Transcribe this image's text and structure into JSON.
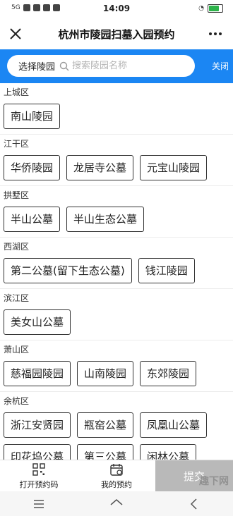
{
  "status": {
    "time": "14:09",
    "network": "5G",
    "battery_level": 0.85,
    "colors": {
      "battery": "#2db34a"
    }
  },
  "header": {
    "title": "杭州市陵园扫墓入园预约"
  },
  "search": {
    "scope_label": "选择陵园",
    "placeholder": "搜索陵园名称",
    "close_label": "关闭",
    "colors": {
      "bar": "#1b86f3"
    }
  },
  "districts": [
    {
      "name": "上城区",
      "cemeteries": [
        "南山陵园"
      ]
    },
    {
      "name": "江干区",
      "cemeteries": [
        "华侨陵园",
        "龙居寺公墓",
        "元宝山陵园"
      ]
    },
    {
      "name": "拱墅区",
      "cemeteries": [
        "半山公墓",
        "半山生态公墓"
      ]
    },
    {
      "name": "西湖区",
      "cemeteries": [
        "第二公墓(留下生态公墓)",
        "钱江陵园"
      ]
    },
    {
      "name": "滨江区",
      "cemeteries": [
        "美女山公墓"
      ]
    },
    {
      "name": "萧山区",
      "cemeteries": [
        "慈福园陵园",
        "山南陵园",
        "东郊陵园"
      ]
    },
    {
      "name": "余杭区",
      "cemeteries": [
        "浙江安贤园",
        "瓶窑公墓",
        "凤凰山公墓",
        "印花坞公墓",
        "第三公墓",
        "闲林公墓"
      ]
    }
  ],
  "bottom_bar": {
    "open_code_label": "打开预约码",
    "my_booking_label": "我的预约",
    "submit_label": "提交",
    "colors": {
      "submit_bg": "#b9b9b9"
    }
  },
  "watermark": "趣下网"
}
